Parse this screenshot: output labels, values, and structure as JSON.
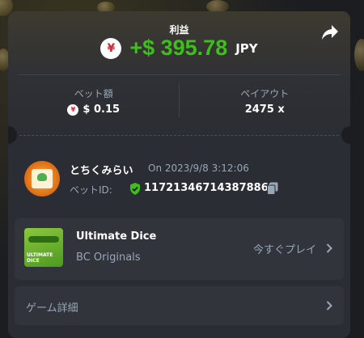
{
  "header": {
    "profit_label": "利益",
    "profit_amount": "+$ 395.78",
    "profit_currency": "JPY",
    "currency_icon": "yen-coin-icon",
    "share_icon": "share-icon"
  },
  "stats": {
    "bet_label": "ベット額",
    "bet_value": "$ 0.15",
    "payout_label": "ペイアウト",
    "payout_value": "2475 x"
  },
  "user": {
    "name": "とちくみらい",
    "date": "On 2023/9/8 3:12:06",
    "bet_id_label": "ベットID:",
    "bet_id_value": "117213467143878868",
    "verified_icon": "shield-check-icon",
    "copy_icon": "copy-icon"
  },
  "game": {
    "name": "Ultimate Dice",
    "provider": "BC Originals",
    "play_label": "今すぐプレイ",
    "thumb_text": "ULTIMATE\nDICE"
  },
  "details": {
    "label": "ゲーム詳細"
  },
  "colors": {
    "profit_green": "#3bc117",
    "card_bg": "#2a2d33",
    "muted_text": "#98a7b5",
    "yen_red": "#d3283c"
  }
}
